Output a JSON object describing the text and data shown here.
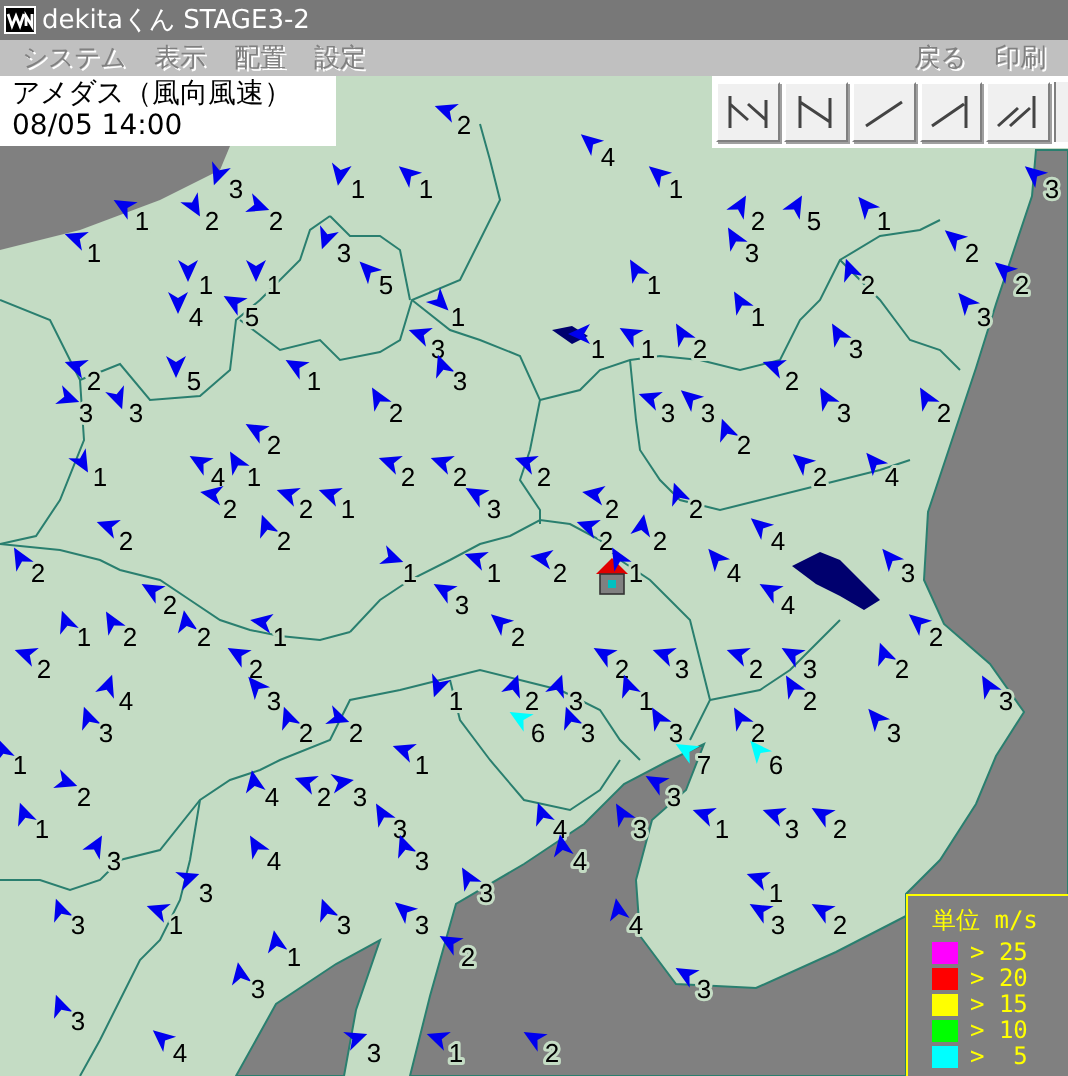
{
  "window": {
    "title": "dekitaくん STAGE3-2"
  },
  "menu": {
    "left": [
      {
        "label": "システム",
        "disabled": true
      },
      {
        "label": "表示",
        "disabled": true
      },
      {
        "label": "配置",
        "disabled": true
      },
      {
        "label": "設定",
        "disabled": true
      }
    ],
    "right": [
      {
        "label": "戻る",
        "disabled": true
      },
      {
        "label": "印刷",
        "disabled": true
      }
    ]
  },
  "overlay": {
    "title": "アメダス（風向風速）",
    "time": "08/05 14:00"
  },
  "stations": [
    {
      "speed": "2"
    },
    {
      "speed": "4"
    },
    {
      "speed": "3"
    },
    {
      "speed": "1"
    },
    {
      "speed": "1"
    },
    {
      "speed": "1"
    },
    {
      "speed": "3"
    },
    {
      "speed": "1"
    },
    {
      "speed": "2"
    },
    {
      "speed": "2"
    },
    {
      "speed": "2"
    },
    {
      "speed": "5"
    },
    {
      "speed": "1"
    },
    {
      "speed": "1"
    },
    {
      "speed": "3"
    },
    {
      "speed": "3"
    },
    {
      "speed": "2"
    },
    {
      "speed": "1"
    },
    {
      "speed": "1"
    },
    {
      "speed": "5"
    },
    {
      "speed": "1"
    },
    {
      "speed": "2"
    },
    {
      "speed": "2"
    },
    {
      "speed": "4"
    },
    {
      "speed": "5"
    },
    {
      "speed": "1"
    },
    {
      "speed": "1"
    },
    {
      "speed": "3"
    },
    {
      "speed": "3"
    },
    {
      "speed": "1"
    },
    {
      "speed": "1"
    },
    {
      "speed": "2"
    },
    {
      "speed": "3"
    },
    {
      "speed": "2"
    },
    {
      "speed": "5"
    },
    {
      "speed": "1"
    },
    {
      "speed": "3"
    },
    {
      "speed": "2"
    },
    {
      "speed": "3"
    },
    {
      "speed": "3"
    },
    {
      "speed": "2"
    },
    {
      "speed": "3"
    },
    {
      "speed": "3"
    },
    {
      "speed": "3"
    },
    {
      "speed": "2"
    },
    {
      "speed": "2"
    },
    {
      "speed": "2"
    },
    {
      "speed": "1"
    },
    {
      "speed": "4"
    },
    {
      "speed": "1"
    },
    {
      "speed": "2"
    },
    {
      "speed": "2"
    },
    {
      "speed": "2"
    },
    {
      "speed": "2"
    },
    {
      "speed": "4"
    },
    {
      "speed": "2"
    },
    {
      "speed": "2"
    },
    {
      "speed": "1"
    },
    {
      "speed": "3"
    },
    {
      "speed": "2"
    },
    {
      "speed": "2"
    },
    {
      "speed": "2"
    },
    {
      "speed": "2"
    },
    {
      "speed": "2"
    },
    {
      "speed": "2"
    },
    {
      "speed": "4"
    },
    {
      "speed": "2"
    },
    {
      "speed": "1"
    },
    {
      "speed": "1"
    },
    {
      "speed": "2"
    },
    {
      "speed": "1"
    },
    {
      "speed": "4"
    },
    {
      "speed": "3"
    },
    {
      "speed": "2"
    },
    {
      "speed": "3"
    },
    {
      "speed": "4"
    },
    {
      "speed": "1"
    },
    {
      "speed": "2"
    },
    {
      "speed": "2"
    },
    {
      "speed": "1"
    },
    {
      "speed": "2"
    },
    {
      "speed": "2"
    },
    {
      "speed": "2"
    },
    {
      "speed": "2"
    },
    {
      "speed": "2"
    },
    {
      "speed": "3"
    },
    {
      "speed": "2"
    },
    {
      "speed": "3"
    },
    {
      "speed": "2"
    },
    {
      "speed": "4"
    },
    {
      "speed": "3"
    },
    {
      "speed": "1"
    },
    {
      "speed": "2"
    },
    {
      "speed": "3"
    },
    {
      "speed": "1"
    },
    {
      "speed": "2"
    },
    {
      "speed": "3"
    },
    {
      "speed": "3"
    },
    {
      "speed": "2"
    },
    {
      "speed": "2"
    },
    {
      "speed": "6"
    },
    {
      "speed": "3"
    },
    {
      "speed": "3"
    },
    {
      "speed": "2"
    },
    {
      "speed": "3"
    },
    {
      "speed": "1"
    },
    {
      "speed": "1"
    },
    {
      "speed": "7"
    },
    {
      "speed": "6"
    },
    {
      "speed": "2"
    },
    {
      "speed": "4"
    },
    {
      "speed": "2"
    },
    {
      "speed": "3"
    },
    {
      "speed": "3"
    },
    {
      "speed": "1"
    },
    {
      "speed": "3"
    },
    {
      "speed": "4"
    },
    {
      "speed": "3"
    },
    {
      "speed": "1"
    },
    {
      "speed": "3"
    },
    {
      "speed": "2"
    },
    {
      "speed": "3"
    },
    {
      "speed": "4"
    },
    {
      "speed": "3"
    },
    {
      "speed": "4"
    },
    {
      "speed": "3"
    },
    {
      "speed": "3"
    },
    {
      "speed": "1"
    },
    {
      "speed": "3"
    },
    {
      "speed": "1"
    },
    {
      "speed": "3"
    },
    {
      "speed": "3"
    },
    {
      "speed": "4"
    },
    {
      "speed": "3"
    },
    {
      "speed": "2"
    },
    {
      "speed": "1"
    },
    {
      "speed": "2"
    },
    {
      "speed": "3"
    },
    {
      "speed": "3"
    },
    {
      "speed": "3"
    },
    {
      "speed": "4"
    },
    {
      "speed": "3"
    },
    {
      "speed": "1"
    },
    {
      "speed": "2"
    }
  ],
  "legend": {
    "title": "単位 m/s",
    "items": [
      {
        "label": "> 25",
        "color": "#ff00ff"
      },
      {
        "label": "> 20",
        "color": "#ff0000"
      },
      {
        "label": "> 15",
        "color": "#ffff00"
      },
      {
        "label": "> 10",
        "color": "#00ff00"
      },
      {
        "label": ">  5",
        "color": "#00ffff"
      }
    ]
  }
}
